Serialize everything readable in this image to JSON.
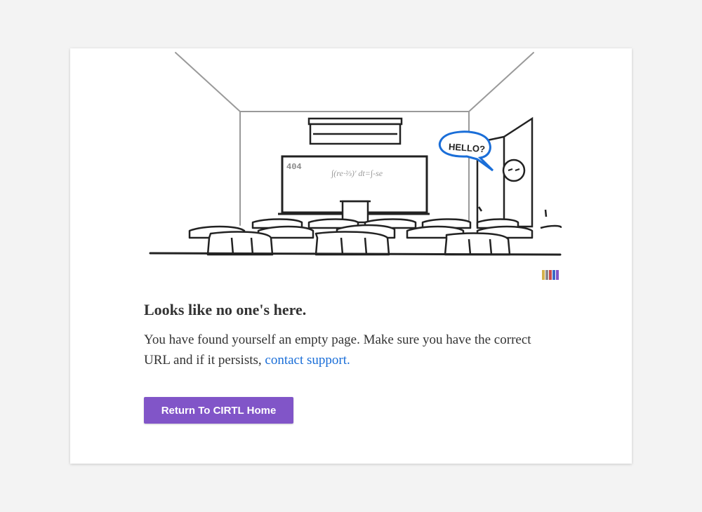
{
  "illustration": {
    "board_text": "404",
    "board_formula": "∫(re·⅔)' dt=∫-se",
    "speech_bubble": "HELLO?"
  },
  "content": {
    "heading": "Looks like no one's here.",
    "message_text": "You have found yourself an empty page. Make sure you have the correct URL and if it persists, ",
    "support_link_label": "contact support."
  },
  "actions": {
    "home_button_label": "Return To CIRTL Home"
  },
  "colors": {
    "accent": "#8155c8",
    "link": "#1a6ed8",
    "bubble": "#1a6ed8"
  }
}
